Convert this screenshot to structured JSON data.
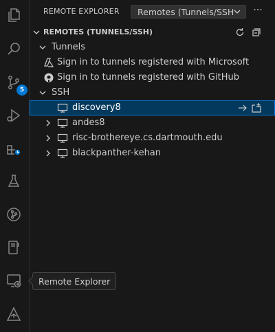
{
  "activity_bar": {
    "items": [
      {
        "name": "explorer-icon"
      },
      {
        "name": "search-icon"
      },
      {
        "name": "source-control-icon",
        "badge": "5"
      },
      {
        "name": "run-debug-icon"
      },
      {
        "name": "extensions-icon"
      },
      {
        "name": "testing-icon"
      },
      {
        "name": "git-graph-icon"
      },
      {
        "name": "notebook-icon"
      },
      {
        "name": "remote-explorer-icon"
      },
      {
        "name": "ai-assistant-icon"
      }
    ],
    "tooltip": "Remote Explorer"
  },
  "sidebar": {
    "title": "REMOTE EXPLORER",
    "dropdown_value": "Remotes (Tunnels/SSH",
    "more_label": "···",
    "section_title": "REMOTES (TUNNELS/SSH)",
    "tunnels_label": "Tunnels",
    "tunnel_items": [
      {
        "label": "Sign in to tunnels registered with Microsoft",
        "icon": "azure-icon"
      },
      {
        "label": "Sign in to tunnels registered with GitHub",
        "icon": "github-icon"
      }
    ],
    "ssh_label": "SSH",
    "ssh_hosts": [
      {
        "label": "discovery8",
        "selected": true
      },
      {
        "label": "andes8",
        "selected": false
      },
      {
        "label": "risc-brothereye.cs.dartmouth.edu",
        "selected": false
      },
      {
        "label": "blackpanther-kehan",
        "selected": false
      }
    ]
  },
  "colors": {
    "accent": "#0078d4",
    "selection_bg": "#04395e",
    "background": "#181818",
    "text": "#cccccc"
  }
}
